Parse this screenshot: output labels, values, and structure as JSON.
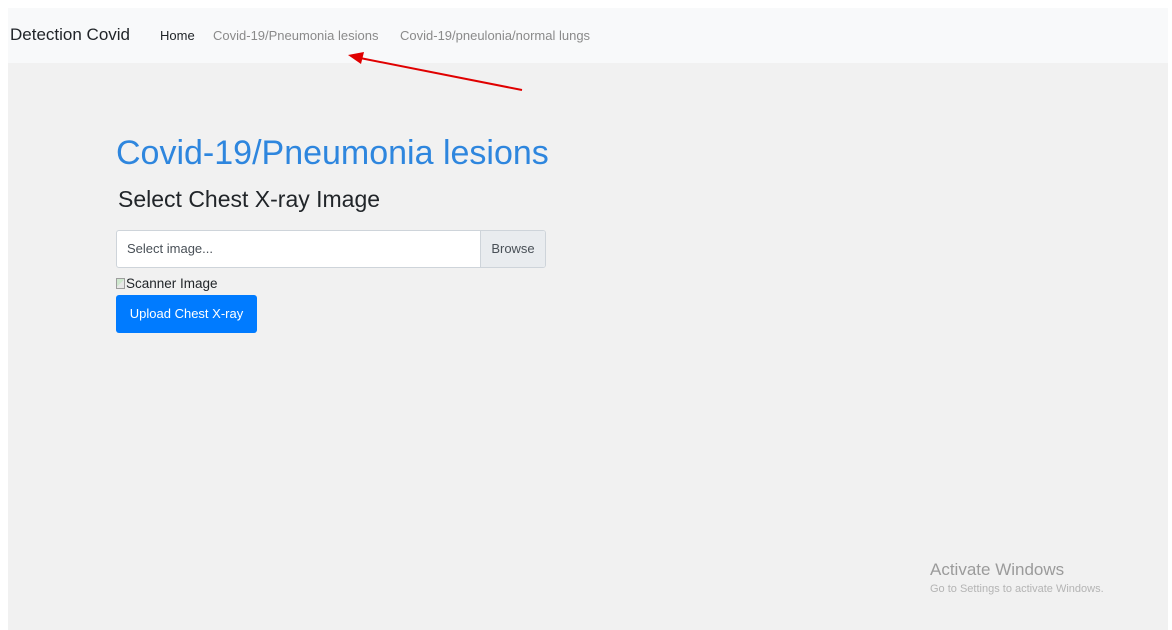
{
  "navbar": {
    "brand": "Detection Covid",
    "links": [
      {
        "label": "Home",
        "active": true
      },
      {
        "label": "Covid-19/Pneumonia lesions",
        "active": false
      },
      {
        "label": "Covid-19/pneulonia/normal lungs",
        "active": false
      }
    ]
  },
  "main": {
    "title": "Covid-19/Pneumonia lesions",
    "subtitle": "Select Chest X-ray Image",
    "file_input": {
      "placeholder": "Select image...",
      "browse_label": "Browse"
    },
    "image_alt": "Scanner Image",
    "upload_button": "Upload Chest X-ray"
  },
  "watermark": {
    "title": "Activate Windows",
    "subtitle": "Go to Settings to activate Windows."
  },
  "colors": {
    "accent_title": "#2e86de",
    "primary_button": "#007bff",
    "annotation_arrow": "#e00000"
  }
}
